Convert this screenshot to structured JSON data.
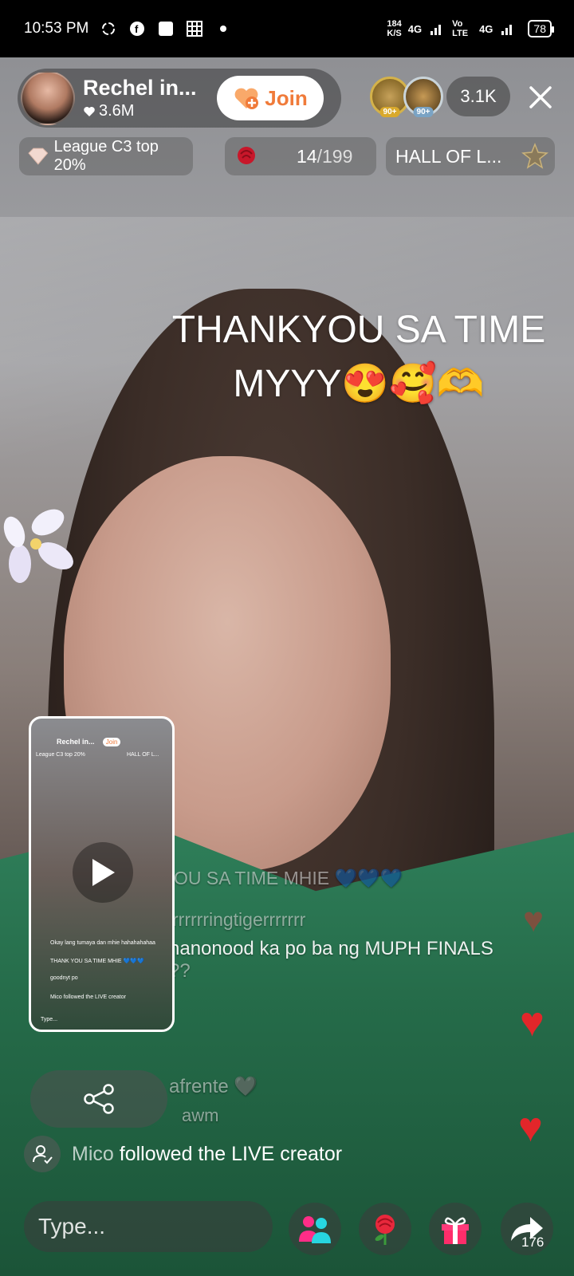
{
  "status_bar": {
    "time": "10:53 PM",
    "net_speed_value": "184",
    "net_speed_unit": "K/S",
    "signal_1": "4G",
    "signal_2": "Vo LTE",
    "signal_3": "4G",
    "battery": "78"
  },
  "host": {
    "name": "Rechel in...",
    "likes": "3.6M",
    "join_label": "Join"
  },
  "viewers": {
    "badges": [
      "90+",
      "90+"
    ],
    "count": "3.1K"
  },
  "chips": {
    "league": "League C3 top 20%",
    "roses_count": "14",
    "roses_goal": "/199",
    "hall": "HALL OF L..."
  },
  "caption": {
    "line1": "THANKYOU SA TIME",
    "line2": "MYYY😍🥰🫶"
  },
  "chat": {
    "line1": "OU SA TIME MHIE 💙💙💙",
    "line2": "rrrrrringtigerrrrrrr",
    "line3": "nanonood ka po ba ng MUPH FINALS",
    "line4": "??",
    "line5": "afrente 🩶",
    "line6": "awm"
  },
  "pip": {
    "name": "Rechel in...",
    "join": "Join",
    "league": "League C3 top 20%",
    "hall": "HALL OF L...",
    "msg1": "Okay lang tumaya dan mhie hahahahahaa",
    "msg2": "THANK YOU SA TIME MHIE 💙💙💙",
    "msg3": "goodnyt po",
    "msg4": "Mico followed the LIVE creator",
    "type": "Type..."
  },
  "follow_notice": {
    "user": "Mico",
    "text": " followed the LIVE creator"
  },
  "bottom": {
    "type_placeholder": "Type...",
    "share_count": "176"
  },
  "colors": {
    "join_text": "#f07b3a",
    "heart": "#e3262a"
  }
}
